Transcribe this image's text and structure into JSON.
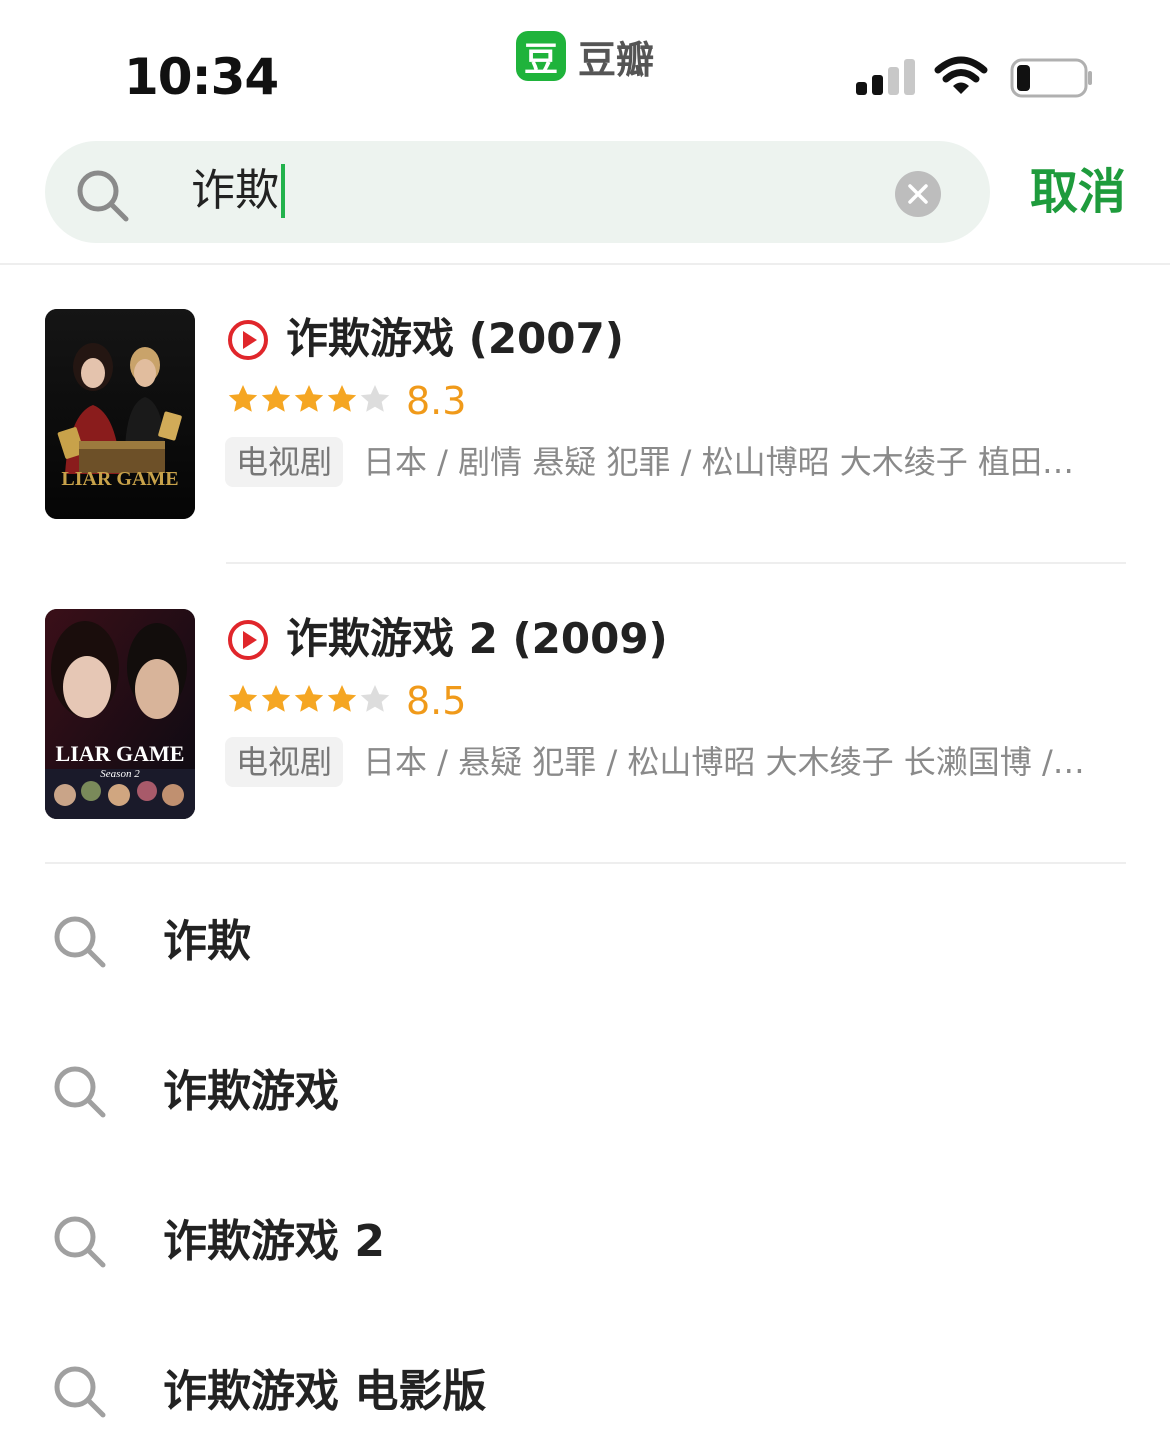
{
  "status_bar": {
    "time": "10:34",
    "app_logo_char": "豆",
    "app_name": "豆瓣",
    "signal_icon": "cellular-signal-icon",
    "wifi_icon": "wifi-icon",
    "battery_icon": "battery-low-icon"
  },
  "search": {
    "query": "诈欺",
    "clear_icon": "clear-circle-icon",
    "cancel_label": "取消"
  },
  "results": [
    {
      "title": "诈欺游戏 (2007)",
      "stars": 4,
      "rating": "8.3",
      "type": "电视剧",
      "meta": "日本 / 剧情 悬疑 犯罪 / 松山博昭 大木绫子 植田…",
      "poster_text": "LIAR GAME",
      "poster_subtext": ""
    },
    {
      "title": "诈欺游戏 2 (2009)",
      "stars": 4,
      "rating": "8.5",
      "type": "电视剧",
      "meta": "日本 / 悬疑 犯罪 / 松山博昭 大木绫子 长濑国博 /…",
      "poster_text": "LIAR GAME",
      "poster_subtext": "Season 2"
    }
  ],
  "suggestions": [
    {
      "text": "诈欺"
    },
    {
      "text": "诈欺游戏"
    },
    {
      "text": "诈欺游戏 2"
    },
    {
      "text": "诈欺游戏 电影版"
    }
  ],
  "colors": {
    "brand_green": "#1fb33b",
    "cancel_green": "#1e9b3c",
    "star_orange": "#f5a623",
    "play_red": "#e0262b"
  }
}
